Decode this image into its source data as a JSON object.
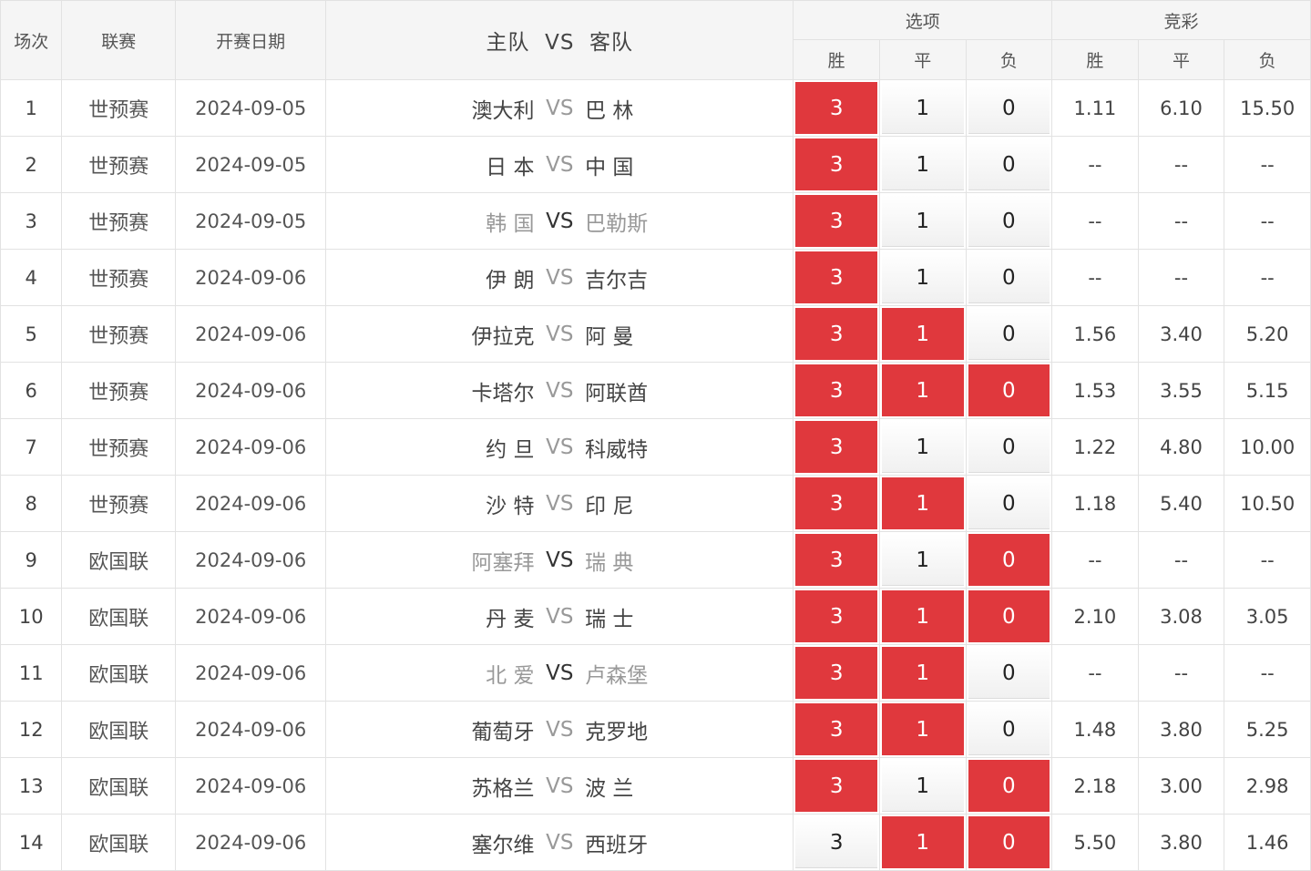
{
  "header": {
    "idx": "场次",
    "league": "联赛",
    "date": "开赛日期",
    "match": "主队  VS  客队",
    "options": "选项",
    "jingcai": "竞彩",
    "win": "胜",
    "draw": "平",
    "loss": "负"
  },
  "rows": [
    {
      "idx": "1",
      "league": "世预赛",
      "date": "2024-09-05",
      "home": "澳大利",
      "vs": "VS",
      "away": "巴 林",
      "muted": false,
      "vs_strong": false,
      "win": "3",
      "draw": "1",
      "loss": "0",
      "w_on": true,
      "d_on": false,
      "l_on": false,
      "o1": "1.11",
      "o2": "6.10",
      "o3": "15.50"
    },
    {
      "idx": "2",
      "league": "世预赛",
      "date": "2024-09-05",
      "home": "日 本",
      "vs": "VS",
      "away": "中 国",
      "muted": false,
      "vs_strong": false,
      "win": "3",
      "draw": "1",
      "loss": "0",
      "w_on": true,
      "d_on": false,
      "l_on": false,
      "o1": "--",
      "o2": "--",
      "o3": "--"
    },
    {
      "idx": "3",
      "league": "世预赛",
      "date": "2024-09-05",
      "home": "韩 国",
      "vs": "VS",
      "away": "巴勒斯",
      "muted": true,
      "vs_strong": true,
      "win": "3",
      "draw": "1",
      "loss": "0",
      "w_on": true,
      "d_on": false,
      "l_on": false,
      "o1": "--",
      "o2": "--",
      "o3": "--"
    },
    {
      "idx": "4",
      "league": "世预赛",
      "date": "2024-09-06",
      "home": "伊 朗",
      "vs": "VS",
      "away": "吉尔吉",
      "muted": false,
      "vs_strong": false,
      "win": "3",
      "draw": "1",
      "loss": "0",
      "w_on": true,
      "d_on": false,
      "l_on": false,
      "o1": "--",
      "o2": "--",
      "o3": "--"
    },
    {
      "idx": "5",
      "league": "世预赛",
      "date": "2024-09-06",
      "home": "伊拉克",
      "vs": "VS",
      "away": "阿 曼",
      "muted": false,
      "vs_strong": false,
      "win": "3",
      "draw": "1",
      "loss": "0",
      "w_on": true,
      "d_on": true,
      "l_on": false,
      "o1": "1.56",
      "o2": "3.40",
      "o3": "5.20"
    },
    {
      "idx": "6",
      "league": "世预赛",
      "date": "2024-09-06",
      "home": "卡塔尔",
      "vs": "VS",
      "away": "阿联酋",
      "muted": false,
      "vs_strong": false,
      "win": "3",
      "draw": "1",
      "loss": "0",
      "w_on": true,
      "d_on": true,
      "l_on": true,
      "o1": "1.53",
      "o2": "3.55",
      "o3": "5.15"
    },
    {
      "idx": "7",
      "league": "世预赛",
      "date": "2024-09-06",
      "home": "约 旦",
      "vs": "VS",
      "away": "科威特",
      "muted": false,
      "vs_strong": false,
      "win": "3",
      "draw": "1",
      "loss": "0",
      "w_on": true,
      "d_on": false,
      "l_on": false,
      "o1": "1.22",
      "o2": "4.80",
      "o3": "10.00"
    },
    {
      "idx": "8",
      "league": "世预赛",
      "date": "2024-09-06",
      "home": "沙 特",
      "vs": "VS",
      "away": "印 尼",
      "muted": false,
      "vs_strong": false,
      "win": "3",
      "draw": "1",
      "loss": "0",
      "w_on": true,
      "d_on": true,
      "l_on": false,
      "o1": "1.18",
      "o2": "5.40",
      "o3": "10.50"
    },
    {
      "idx": "9",
      "league": "欧国联",
      "date": "2024-09-06",
      "home": "阿塞拜",
      "vs": "VS",
      "away": "瑞 典",
      "muted": true,
      "vs_strong": true,
      "win": "3",
      "draw": "1",
      "loss": "0",
      "w_on": true,
      "d_on": false,
      "l_on": true,
      "o1": "--",
      "o2": "--",
      "o3": "--"
    },
    {
      "idx": "10",
      "league": "欧国联",
      "date": "2024-09-06",
      "home": "丹 麦",
      "vs": "VS",
      "away": "瑞 士",
      "muted": false,
      "vs_strong": false,
      "win": "3",
      "draw": "1",
      "loss": "0",
      "w_on": true,
      "d_on": true,
      "l_on": true,
      "o1": "2.10",
      "o2": "3.08",
      "o3": "3.05"
    },
    {
      "idx": "11",
      "league": "欧国联",
      "date": "2024-09-06",
      "home": "北 爱",
      "vs": "VS",
      "away": "卢森堡",
      "muted": true,
      "vs_strong": true,
      "win": "3",
      "draw": "1",
      "loss": "0",
      "w_on": true,
      "d_on": true,
      "l_on": false,
      "o1": "--",
      "o2": "--",
      "o3": "--"
    },
    {
      "idx": "12",
      "league": "欧国联",
      "date": "2024-09-06",
      "home": "葡萄牙",
      "vs": "VS",
      "away": "克罗地",
      "muted": false,
      "vs_strong": false,
      "win": "3",
      "draw": "1",
      "loss": "0",
      "w_on": true,
      "d_on": true,
      "l_on": false,
      "o1": "1.48",
      "o2": "3.80",
      "o3": "5.25"
    },
    {
      "idx": "13",
      "league": "欧国联",
      "date": "2024-09-06",
      "home": "苏格兰",
      "vs": "VS",
      "away": "波 兰",
      "muted": false,
      "vs_strong": false,
      "win": "3",
      "draw": "1",
      "loss": "0",
      "w_on": true,
      "d_on": false,
      "l_on": true,
      "o1": "2.18",
      "o2": "3.00",
      "o3": "2.98"
    },
    {
      "idx": "14",
      "league": "欧国联",
      "date": "2024-09-06",
      "home": "塞尔维",
      "vs": "VS",
      "away": "西班牙",
      "muted": false,
      "vs_strong": false,
      "win": "3",
      "draw": "1",
      "loss": "0",
      "w_on": false,
      "d_on": true,
      "l_on": true,
      "o1": "5.50",
      "o2": "3.80",
      "o3": "1.46"
    }
  ],
  "colors": {
    "selected": "#e0383d",
    "muted_text": "#999999"
  }
}
